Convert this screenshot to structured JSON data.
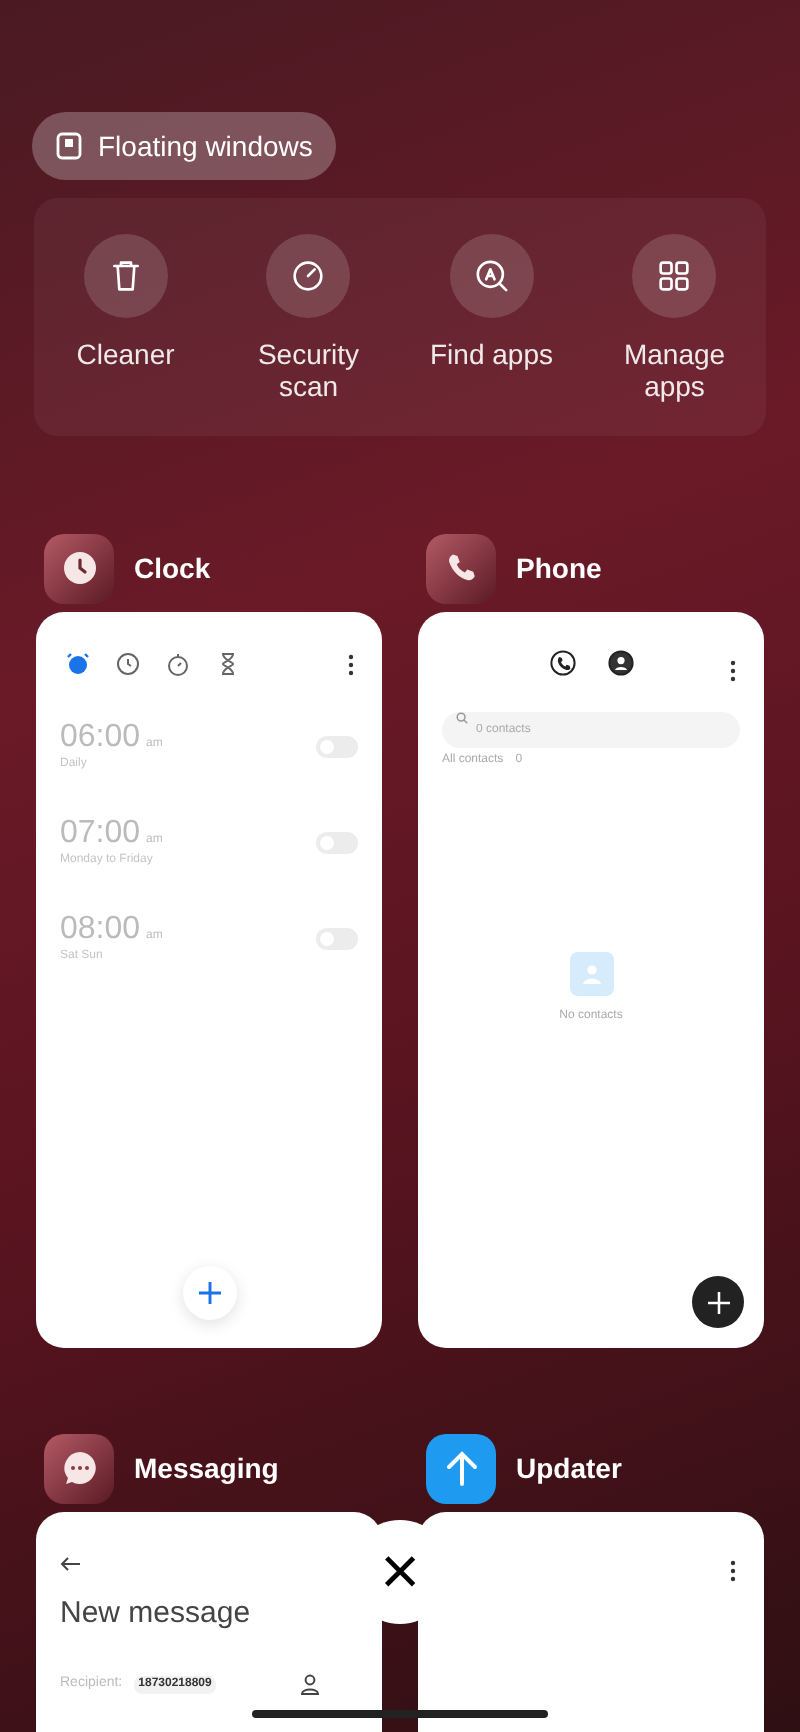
{
  "floating_windows_button": {
    "label": "Floating windows"
  },
  "quick_actions": [
    {
      "label": "Cleaner",
      "kind": "trash"
    },
    {
      "label": "Security scan",
      "kind": "gauge"
    },
    {
      "label": "Find apps",
      "kind": "find"
    },
    {
      "label": "Manage apps",
      "kind": "grid"
    }
  ],
  "apps": [
    {
      "name": "Clock",
      "kind": "clock",
      "tabs": [
        {
          "kind": "alarm",
          "selected": true
        },
        {
          "kind": "clock",
          "selected": false
        },
        {
          "kind": "stopwatch",
          "selected": false
        },
        {
          "kind": "timer",
          "selected": false
        }
      ],
      "alarms": [
        {
          "time": "06:00",
          "period": "am",
          "repeat": "Daily",
          "on": false
        },
        {
          "time": "07:00",
          "period": "am",
          "repeat": "Monday to Friday",
          "on": false
        },
        {
          "time": "08:00",
          "period": "am",
          "repeat": "Sat Sun",
          "on": false
        }
      ]
    },
    {
      "name": "Phone",
      "kind": "phone",
      "tabs": [
        {
          "kind": "calls",
          "selected": false
        },
        {
          "kind": "contacts",
          "selected": true
        }
      ],
      "search": {
        "placeholder": "0 contacts"
      },
      "section": {
        "label": "All contacts",
        "count": "0"
      },
      "empty": "No contacts"
    },
    {
      "name": "Messaging",
      "kind": "messaging",
      "title": "New message",
      "recipient": {
        "label": "Recipient:",
        "chip": "18730218809"
      }
    },
    {
      "name": "Updater",
      "kind": "updater"
    }
  ],
  "close_button": {
    "label": "×"
  }
}
